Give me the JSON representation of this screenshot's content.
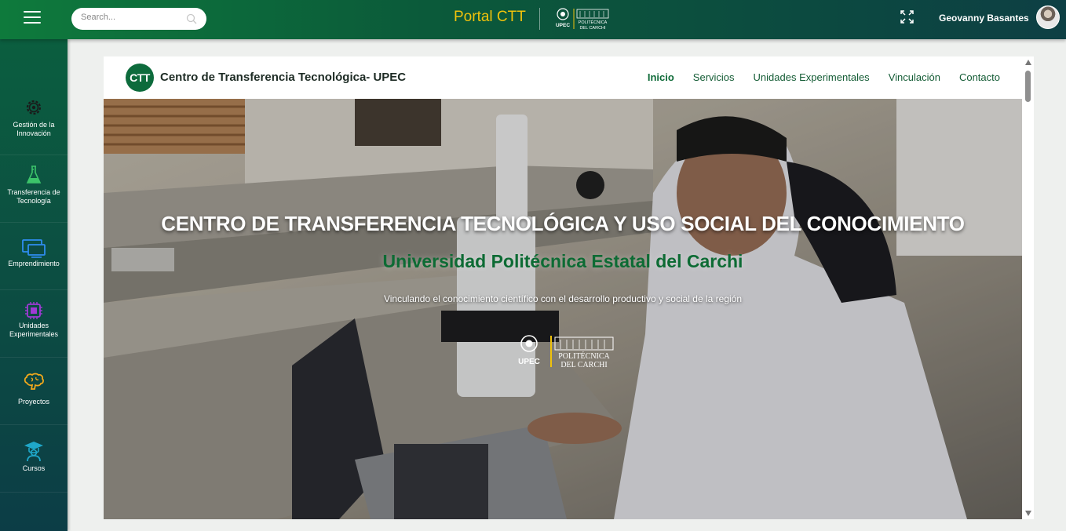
{
  "topbar": {
    "search_placeholder": "Search...",
    "portal_title": "Portal CTT",
    "logo_upec": "UPEC",
    "logo_line1": "POLITÉCNICA",
    "logo_line2": "DEL CARCHI",
    "username": "Geovanny Basantes"
  },
  "sidebar": {
    "items": [
      {
        "label": "Gestión de la Innovación",
        "icon": "gear-icon",
        "color": "#1a1a1a"
      },
      {
        "label": "Transferencia de Tecnología",
        "icon": "flask-icon",
        "color": "#3cc46a"
      },
      {
        "label": "Emprendimiento",
        "icon": "monitor-icon",
        "color": "#2f8df0"
      },
      {
        "label": "Unidades Experimentales",
        "icon": "chip-icon",
        "color": "#a13ad6"
      },
      {
        "label": "Proyectos",
        "icon": "brain-icon",
        "color": "#f0a81c"
      },
      {
        "label": "Cursos",
        "icon": "graduate-icon",
        "color": "#1fa7c9"
      }
    ]
  },
  "site": {
    "logo_text": "CTT",
    "title": "Centro de Transferencia Tecnológica- UPEC",
    "nav": [
      "Inicio",
      "Servicios",
      "Unidades Experimentales",
      "Vinculación",
      "Contacto"
    ],
    "active_nav": "Inicio"
  },
  "hero": {
    "title": "CENTRO DE TRANSFERENCIA TECNOLÓGICA Y USO SOCIAL DEL CONOCIMIENTO",
    "subtitle": "Universidad Politécnica Estatal del Carchi",
    "description": "Vinculando el conocimiento científico con el desarrollo productivo y social de la región",
    "logo_upec": "UPEC",
    "logo_line1": "POLITÉCNICA",
    "logo_line2": "DEL CARCHI"
  },
  "colors": {
    "brand_green": "#0d6b3c",
    "accent_yellow": "#f0c20b"
  }
}
